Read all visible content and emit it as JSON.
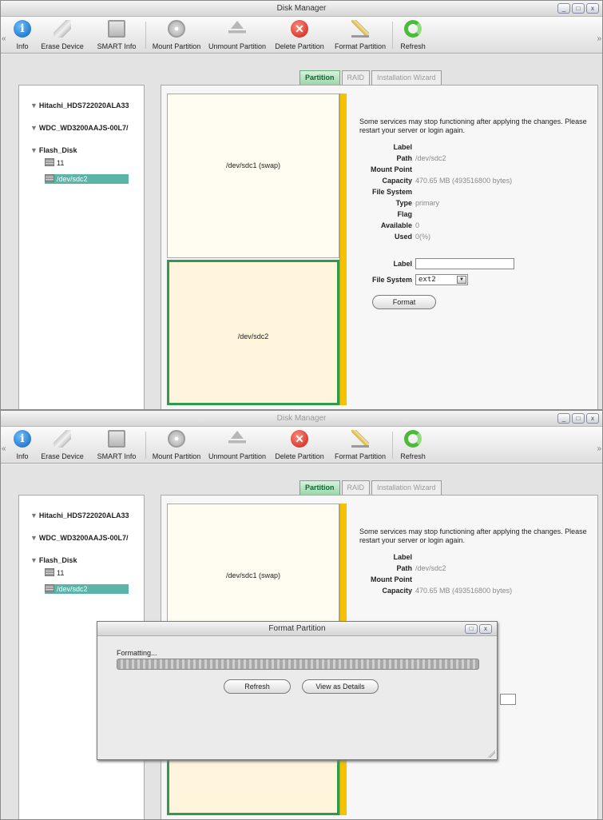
{
  "app": {
    "title": "Disk Manager",
    "window_buttons": [
      "_",
      "□",
      "x"
    ]
  },
  "toolbar": {
    "left_arrow": "«",
    "right_arrow": "»",
    "buttons": [
      {
        "label": "Info",
        "icon": "info-icon"
      },
      {
        "label": "Erase Device",
        "icon": "eraser-icon"
      },
      {
        "label": "SMART Info",
        "icon": "disk-health-icon"
      },
      {
        "label": "Mount Partition",
        "icon": "disc-icon"
      },
      {
        "label": "Unmount Partition",
        "icon": "eject-icon"
      },
      {
        "label": "Delete Partition",
        "icon": "delete-icon"
      },
      {
        "label": "Format Partition",
        "icon": "pencil-icon"
      },
      {
        "label": "Refresh",
        "icon": "refresh-icon"
      }
    ]
  },
  "tree": {
    "disks": [
      {
        "label": "Hitachi_HDS722020ALA33",
        "arrow": "▼"
      },
      {
        "label": "WDC_WD3200AAJS-00L7/",
        "arrow": "▼"
      },
      {
        "label": "Flash_Disk",
        "arrow": "▼"
      }
    ],
    "items": [
      {
        "label": "11"
      },
      {
        "label": "/dev/sdc2"
      }
    ]
  },
  "tabs": [
    {
      "label": "Partition",
      "active": true
    },
    {
      "label": "RAID",
      "active": false
    },
    {
      "label": "Installation Wizard",
      "active": false
    }
  ],
  "partitions": [
    {
      "label": "/dev/sdc1 (swap)"
    },
    {
      "label": "/dev/sdc2"
    }
  ],
  "info": {
    "notice": "Some services may stop functioning after applying the changes. Please restart your server or login again.",
    "rows": [
      {
        "key": "Label",
        "value": ""
      },
      {
        "key": "Path",
        "value": "/dev/sdc2"
      },
      {
        "key": "Mount Point",
        "value": ""
      },
      {
        "key": "Capacity",
        "value": "470.65 MB (493516800 bytes)"
      },
      {
        "key": "File System",
        "value": ""
      },
      {
        "key": "Type",
        "value": "primary"
      },
      {
        "key": "Flag",
        "value": ""
      },
      {
        "key": "Available",
        "value": "0"
      },
      {
        "key": "Used",
        "value": "0(%)"
      }
    ]
  },
  "format_form": {
    "label_key": "Label",
    "label_value": "",
    "fs_key": "File System",
    "fs_value": "ext2",
    "dropdown": "▼",
    "button": "Format"
  },
  "dialog": {
    "title": "Format Partition",
    "message": "Formatting...",
    "progress": "indeterminate",
    "buttons": [
      "Refresh",
      "View as Details"
    ],
    "window_buttons": [
      "□",
      "x"
    ]
  },
  "colors": {
    "accent_green": "#2f9a4d",
    "selection": "#5ab4a8",
    "free_space": "#f6c200"
  }
}
